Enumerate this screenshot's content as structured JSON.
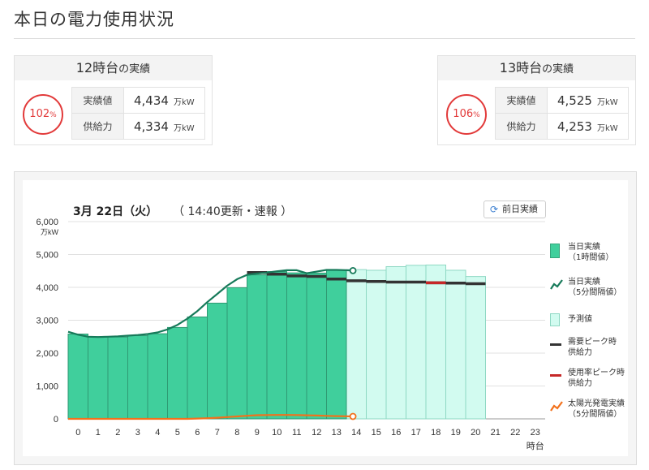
{
  "page": {
    "title": "本日の電力使用状況"
  },
  "cards": [
    {
      "hour_label": "12時台",
      "suffix": "の実績",
      "ratio": "102",
      "ratio_unit": "%",
      "actual_label": "実績値",
      "actual": "4,434",
      "supply_label": "供給力",
      "supply": "4,334",
      "unit": "万kW"
    },
    {
      "hour_label": "13時台",
      "suffix": "の実績",
      "ratio": "106",
      "ratio_unit": "%",
      "actual_label": "実績値",
      "actual": "4,525",
      "supply_label": "供給力",
      "supply": "4,253",
      "unit": "万kW"
    }
  ],
  "chart_header": {
    "date": "3月 22日（火）",
    "update": "（ 14:40更新・速報 ）",
    "prev_button": "前日実績"
  },
  "legend": {
    "actual_hourly": [
      "当日実績",
      "（1時間値）"
    ],
    "actual_5min": [
      "当日実績",
      "（5分間隔値）"
    ],
    "forecast": [
      "予測値"
    ],
    "peak_supply": [
      "需要ピーク時",
      "供給力"
    ],
    "rate_peak_supply": [
      "使用率ピーク時",
      "供給力"
    ],
    "solar": [
      "太陽光発電実績",
      "（5分間隔値）"
    ]
  },
  "colors": {
    "actual_bar": "#40cf9c",
    "actual_line": "#177a5a",
    "forecast_bar": "#d2fbf0",
    "supply": "#333333",
    "rate_peak": "#c62828",
    "solar": "#f2711c",
    "ratio_circle": "#e23a3a"
  },
  "chart_data": {
    "type": "bar",
    "x": [
      0,
      1,
      2,
      3,
      4,
      5,
      6,
      7,
      8,
      9,
      10,
      11,
      12,
      13,
      14,
      15,
      16,
      17,
      18,
      19,
      20,
      21,
      22,
      23
    ],
    "xlabel": "時台",
    "ylabel": "万kW",
    "ylim": [
      0,
      6000
    ],
    "yticks": [
      "0",
      "1,000",
      "2,000",
      "3,000",
      "4,000",
      "5,000",
      "6,000"
    ],
    "grid": true,
    "legend_position": "right",
    "series": [
      {
        "name": "当日実績（1時間値）",
        "type": "bar",
        "x": [
          0,
          1,
          2,
          3,
          4,
          5,
          6,
          7,
          8,
          9,
          10,
          11,
          12,
          13
        ],
        "values": [
          2580,
          2500,
          2490,
          2530,
          2590,
          2780,
          3100,
          3520,
          3990,
          4380,
          4480,
          4440,
          4434,
          4525
        ]
      },
      {
        "name": "予測値",
        "type": "bar",
        "x": [
          14,
          15,
          16,
          17,
          18,
          19,
          20
        ],
        "values": [
          4540,
          4520,
          4630,
          4670,
          4680,
          4520,
          4330
        ]
      },
      {
        "name": "当日実績（5分間隔値）",
        "type": "line",
        "x": [
          0,
          0.5,
          1,
          1.5,
          2,
          2.5,
          3,
          3.5,
          4,
          4.5,
          5,
          5.5,
          6,
          6.5,
          7,
          7.5,
          8,
          8.5,
          9,
          9.5,
          10,
          10.5,
          11,
          11.5,
          12,
          12.5,
          13,
          13.5,
          14,
          14.33
        ],
        "values": [
          2650,
          2560,
          2500,
          2490,
          2500,
          2510,
          2530,
          2550,
          2580,
          2630,
          2720,
          2860,
          3050,
          3280,
          3550,
          3800,
          4050,
          4250,
          4380,
          4420,
          4450,
          4490,
          4520,
          4520,
          4430,
          4480,
          4530,
          4530,
          4520,
          4510
        ]
      },
      {
        "name": "需要ピーク時供給力",
        "type": "step",
        "x": [
          9,
          10,
          11,
          12,
          13,
          14,
          15,
          16,
          17,
          18,
          19,
          20
        ],
        "values": [
          4450,
          4400,
          4350,
          4334,
          4253,
          4200,
          4180,
          4160,
          4160,
          4140,
          4130,
          4110
        ]
      },
      {
        "name": "使用率ピーク時供給力",
        "type": "step",
        "x": [
          18
        ],
        "values": [
          4140
        ]
      },
      {
        "name": "太陽光発電実績（5分間隔値）",
        "type": "line",
        "x": [
          0,
          6,
          6.5,
          7,
          7.5,
          8,
          8.5,
          9,
          9.5,
          10,
          10.5,
          11,
          11.5,
          12,
          12.5,
          13,
          13.5,
          14,
          14.33
        ],
        "values": [
          0,
          0,
          10,
          20,
          35,
          55,
          75,
          95,
          110,
          115,
          118,
          118,
          115,
          108,
          100,
          92,
          85,
          80,
          75
        ]
      }
    ]
  }
}
